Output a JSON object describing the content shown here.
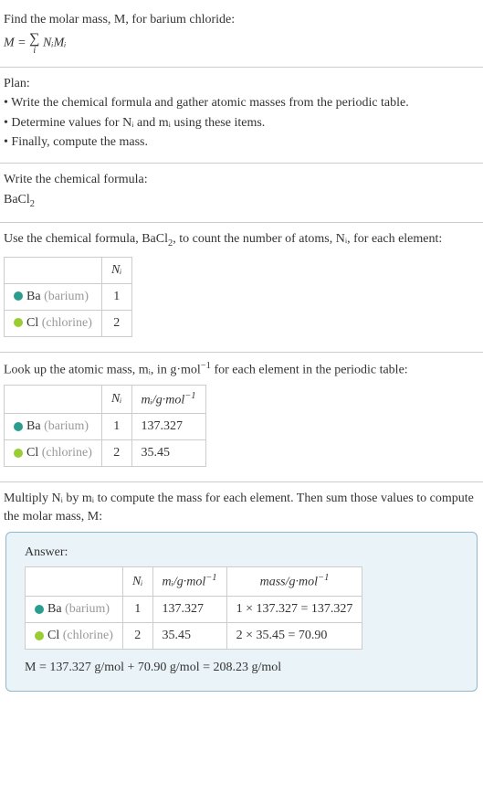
{
  "intro": {
    "line1": "Find the molar mass, M, for barium chloride:",
    "formula_lhs": "M = ",
    "formula_sigma": "∑",
    "formula_sub": "i",
    "formula_rhs": " NᵢMᵢ"
  },
  "plan": {
    "title": "Plan:",
    "bullet1": "• Write the chemical formula and gather atomic masses from the periodic table.",
    "bullet2": "• Determine values for Nᵢ and mᵢ using these items.",
    "bullet3": "• Finally, compute the mass."
  },
  "writeFormula": {
    "title": "Write the chemical formula:",
    "formula_main": "BaCl",
    "formula_sub": "2"
  },
  "countAtoms": {
    "text_pre": "Use the chemical formula, BaCl",
    "text_sub": "2",
    "text_post": ", to count the number of atoms, Nᵢ, for each element:",
    "header_n": "Nᵢ",
    "rows": [
      {
        "color": "#2a9d8f",
        "el": "Ba",
        "paren": "(barium)",
        "n": "1"
      },
      {
        "color": "#9acd32",
        "el": "Cl",
        "paren": "(chlorine)",
        "n": "2"
      }
    ]
  },
  "atomicMass": {
    "text_pre": "Look up the atomic mass, mᵢ, in g·mol",
    "text_sup": "−1",
    "text_post": " for each element in the periodic table:",
    "header_n": "Nᵢ",
    "header_m_pre": "mᵢ/g·mol",
    "header_m_sup": "−1",
    "rows": [
      {
        "color": "#2a9d8f",
        "el": "Ba",
        "paren": "(barium)",
        "n": "1",
        "m": "137.327"
      },
      {
        "color": "#9acd32",
        "el": "Cl",
        "paren": "(chlorine)",
        "n": "2",
        "m": "35.45"
      }
    ]
  },
  "multiply": {
    "text": "Multiply Nᵢ by mᵢ to compute the mass for each element. Then sum those values to compute the molar mass, M:"
  },
  "answer": {
    "label": "Answer:",
    "header_n": "Nᵢ",
    "header_m_pre": "mᵢ/g·mol",
    "header_m_sup": "−1",
    "header_mass_pre": "mass/g·mol",
    "header_mass_sup": "−1",
    "rows": [
      {
        "color": "#2a9d8f",
        "el": "Ba",
        "paren": "(barium)",
        "n": "1",
        "m": "137.327",
        "mass": "1 × 137.327 = 137.327"
      },
      {
        "color": "#9acd32",
        "el": "Cl",
        "paren": "(chlorine)",
        "n": "2",
        "m": "35.45",
        "mass": "2 × 35.45 = 70.90"
      }
    ],
    "result": "M = 137.327 g/mol + 70.90 g/mol = 208.23 g/mol"
  }
}
